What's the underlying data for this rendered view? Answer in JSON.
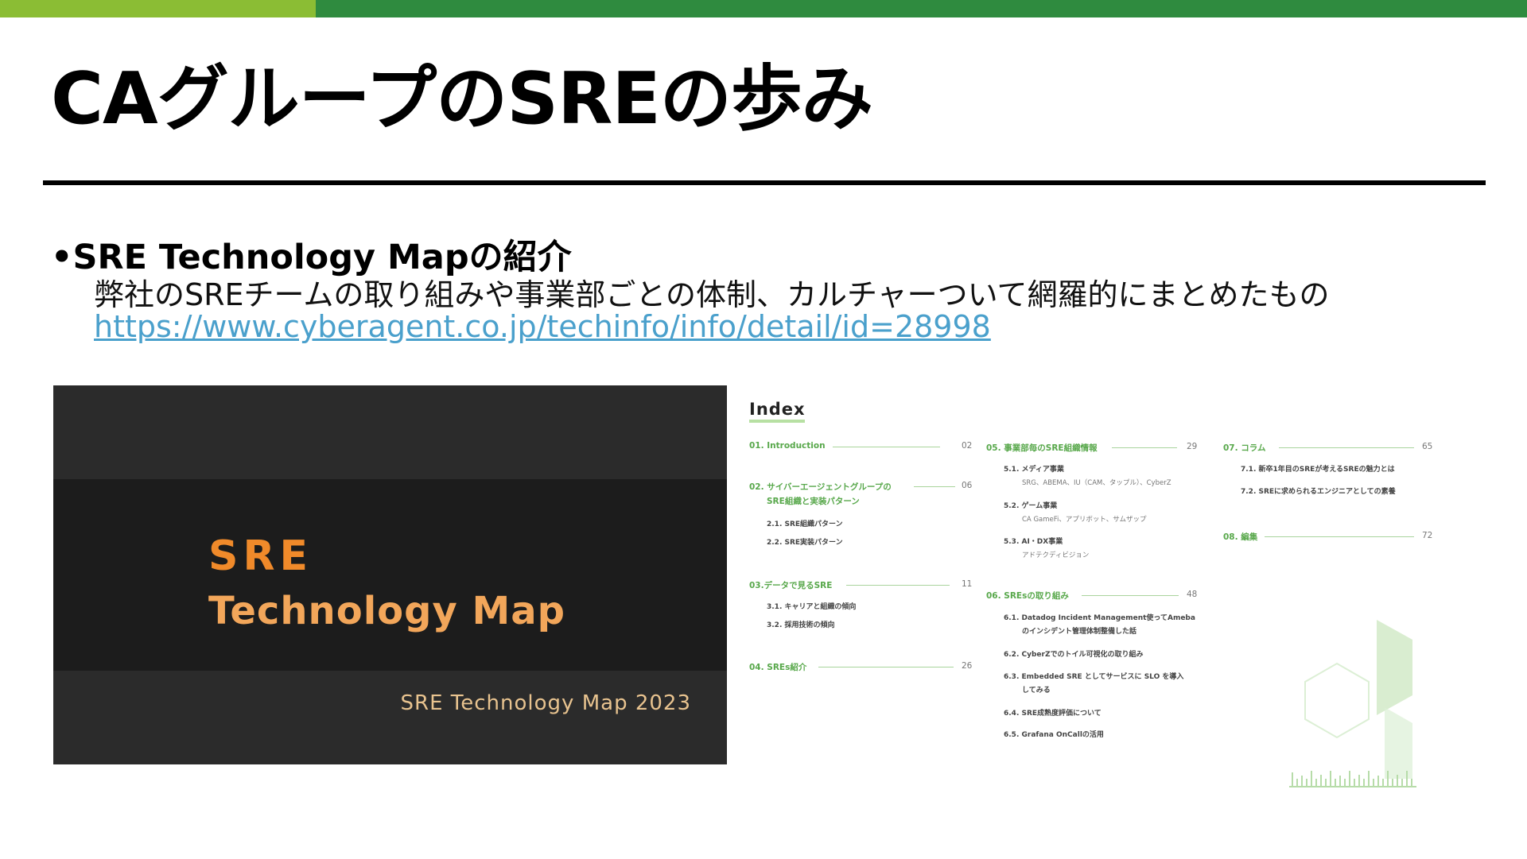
{
  "slide": {
    "title": "CAグループのSREの歩み",
    "bullet_heading": "•SRE Technology Mapの紹介",
    "bullet_text": "弊社のSREチームの取り組みや事業部ごとの体制、カルチャーついて網羅的にまとめたもの",
    "link": "https://www.cyberagent.co.jp/techinfo/info/detail/id=28998"
  },
  "colors": {
    "bar_light_green": "#8bbd34",
    "bar_dark_green": "#2f8b3f",
    "link": "#4aa0cc",
    "index_green": "#58a84b",
    "cover_orange": "#f08a2a"
  },
  "cover": {
    "logo_line1": "SRE",
    "logo_line2": "Technology Map",
    "caption": "SRE Technology Map 2023"
  },
  "index": {
    "title": "Index",
    "col1": {
      "e1": {
        "label": "01. Introduction",
        "page": "02"
      },
      "e2": {
        "label1": "02. サイバーエージェントグループの",
        "label2": "SRE組織と実装パターン",
        "page": "06"
      },
      "e2_s1": "2.1.  SRE組織パターン",
      "e2_s2": "2.2.  SRE実装パターン",
      "e3": {
        "label": "03.データで見るSRE",
        "page": "11"
      },
      "e3_s1": "3.1.  キャリアと組織の傾向",
      "e3_s2": "3.2.  採用技術の傾向",
      "e4": {
        "label": "04. SREs紹介",
        "page": "26"
      }
    },
    "col2": {
      "e5": {
        "label": "05. 事業部毎のSRE組織情報",
        "page": "29"
      },
      "e5_s1": "5.1.  メディア事業",
      "e5_s1_d": "SRG、ABEMA、IU（CAM、タップル）、CyberZ",
      "e5_s2": "5.2.  ゲーム事業",
      "e5_s2_d": "CA GameFi、アプリボット、サムザップ",
      "e5_s3": "5.3.  AI・DX事業",
      "e5_s3_d": "アドテクディビジョン",
      "e6": {
        "label": "06. SREsの取り組み",
        "page": "48"
      },
      "e6_s1a": "6.1.  Datadog Incident Management使ってAmeba",
      "e6_s1b": "のインシデント管理体制整備した話",
      "e6_s2": "6.2.  CyberZでのトイル可視化の取り組み",
      "e6_s3a": "6.3.  Embedded SRE としてサービスに SLO を導入",
      "e6_s3b": "してみる",
      "e6_s4": "6.4.  SRE成熟度評価について",
      "e6_s5": "6.5.  Grafana OnCallの活用"
    },
    "col3": {
      "e7": {
        "label": "07. コラム",
        "page": "65"
      },
      "e7_s1": "7.1.  新卒1年目のSREが考えるSREの魅力とは",
      "e7_s2": "7.2.  SREに求められるエンジニアとしての素養",
      "e8": {
        "label": "08. 編集",
        "page": "72"
      }
    }
  }
}
